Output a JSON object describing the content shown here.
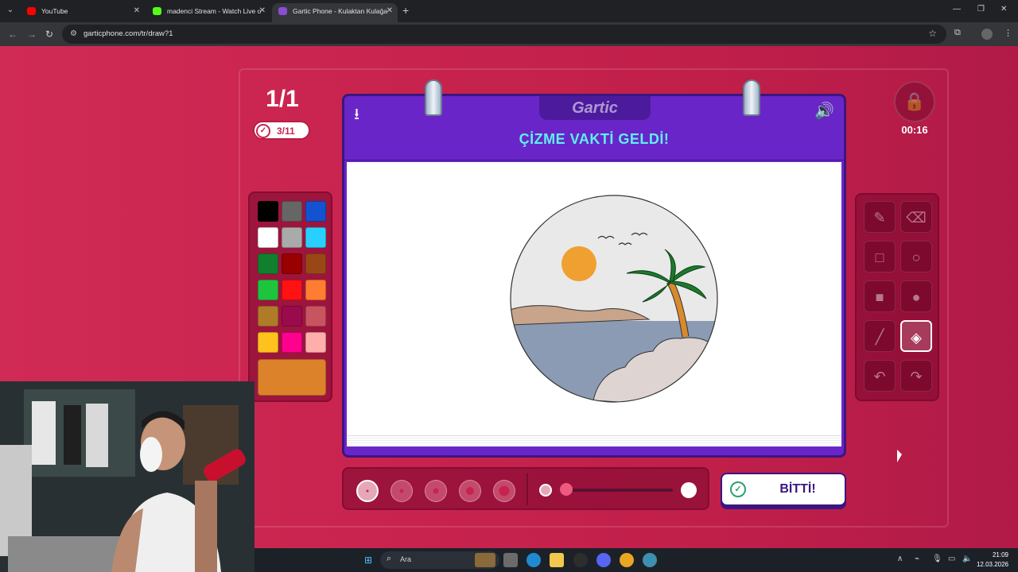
{
  "browser": {
    "tabs": [
      {
        "label": "YouTube",
        "favicon_color": "#ff0000"
      },
      {
        "label": "madenci Stream - Watch Live o",
        "favicon_color": "#53fc18"
      },
      {
        "label": "Gartic Phone - Kulaktan Kulağa",
        "favicon_color": "#8a4dd6"
      }
    ],
    "url": "garticphone.com/tr/draw?1"
  },
  "game": {
    "logo": "Gartic",
    "round": "1/1",
    "players_done": "3/11",
    "timer": "00:16",
    "title": "ÇİZME VAKTİ GELDİ!",
    "done_button": "BİTTİ!",
    "palette": [
      "#000000",
      "#666666",
      "#1353d1",
      "#ffffff",
      "#aaaaaa",
      "#29d0ff",
      "#117f2d",
      "#990000",
      "#994815",
      "#1ec43c",
      "#ff1212",
      "#ff7d31",
      "#b07b29",
      "#990b4d",
      "#c85460",
      "#ffc11d",
      "#ff008f",
      "#feafab"
    ],
    "current_color": "#dc822b",
    "tools": [
      "pencil-icon",
      "eraser-icon",
      "square-outline-icon",
      "circle-outline-icon",
      "square-filled-icon",
      "circle-filled-icon",
      "line-icon",
      "bucket-icon",
      "undo-icon",
      "redo-icon"
    ],
    "active_tool": "bucket-icon",
    "brush_sizes": 5,
    "selected_size": 0,
    "opacity": 0.2
  },
  "taskbar": {
    "search_placeholder": "Ara",
    "time": "21:09",
    "date": "12.03.2026"
  }
}
